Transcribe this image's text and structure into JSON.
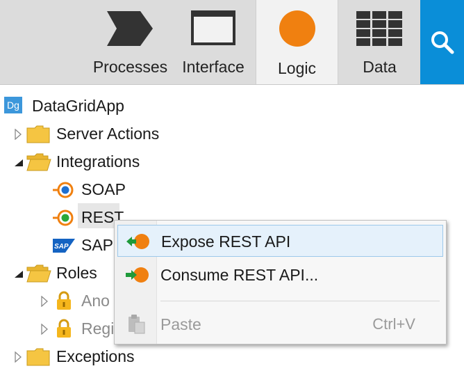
{
  "tabs": [
    {
      "label": "Processes",
      "icon": "processes-chevron-icon",
      "active": false
    },
    {
      "label": "Interface",
      "icon": "window-icon",
      "active": false
    },
    {
      "label": "Logic",
      "icon": "orange-circle-icon",
      "active": true
    },
    {
      "label": "Data",
      "icon": "grid-table-icon",
      "active": false
    }
  ],
  "search": {
    "icon": "search-icon"
  },
  "tree": {
    "app": {
      "badge": "Dg",
      "label": "DataGridApp"
    },
    "server_actions": "Server Actions",
    "integrations": "Integrations",
    "soap": "SOAP",
    "rest": "REST",
    "sap": "SAP",
    "sap_logo": "SAP",
    "roles": "Roles",
    "role_anonymous": "Ano",
    "role_registered": "Regi",
    "exceptions": "Exceptions"
  },
  "context_menu": {
    "expose": "Expose REST API",
    "consume": "Consume REST API...",
    "paste": "Paste",
    "paste_shortcut": "Ctrl+V"
  },
  "colors": {
    "accent_blue": "#0a8ed8",
    "logic_orange": "#f08010",
    "folder_yellow": "#f5c542",
    "tab_bar": "#dcdcdc"
  }
}
